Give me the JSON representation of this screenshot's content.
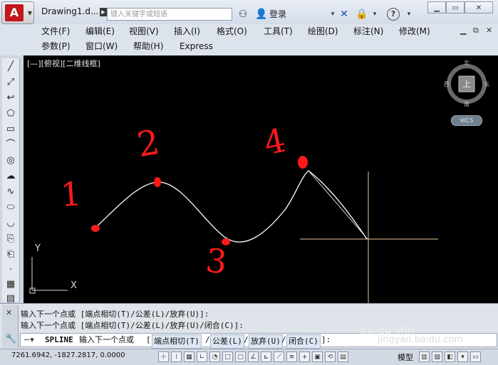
{
  "titlebar": {
    "document_title": "Drawing1.d...",
    "search_placeholder": "键入关键字或短语",
    "login_label": "登录"
  },
  "menu": {
    "row1": [
      "文件(F)",
      "编辑(E)",
      "视图(V)",
      "插入(I)",
      "格式(O)",
      "工具(T)",
      "绘图(D)",
      "标注(N)",
      "修改(M)"
    ],
    "row2": [
      "参数(P)",
      "窗口(W)",
      "帮助(H)",
      "Express"
    ]
  },
  "canvas": {
    "viewport_label": "[—][俯视][二维线框]",
    "viewcube": {
      "north": "北",
      "south": "南",
      "east": "东",
      "west": "西",
      "face": "上"
    },
    "wcs_label": "WCS",
    "ucs": {
      "y": "Y",
      "x": "X"
    },
    "annotations": [
      "1",
      "2",
      "3",
      "4"
    ]
  },
  "command": {
    "history": [
      "输入下一个点或 [端点相切(T)/公差(L)/放弃(U)]:",
      "输入下一个点或 [端点相切(T)/公差(L)/放弃(U)/闭合(C)]:"
    ],
    "prompt_command": "SPLINE",
    "prompt_text": "输入下一个点或",
    "options": [
      "端点相切(T)",
      "公差(L)",
      "放弃(U)",
      "闭合(C)"
    ],
    "prompt_tail": "]:"
  },
  "status": {
    "coordinates": "7261.6942, -1827.2817, 0.0000",
    "model_label": "模型"
  },
  "watermark": {
    "line1": "Baidu 经验",
    "line2": "jingyan.baidu.com"
  },
  "colors": {
    "canvas_bg": "#000000",
    "spline": "#ffffff",
    "annotation": "#ff1a1a",
    "crosshair": "#e8c89a"
  }
}
